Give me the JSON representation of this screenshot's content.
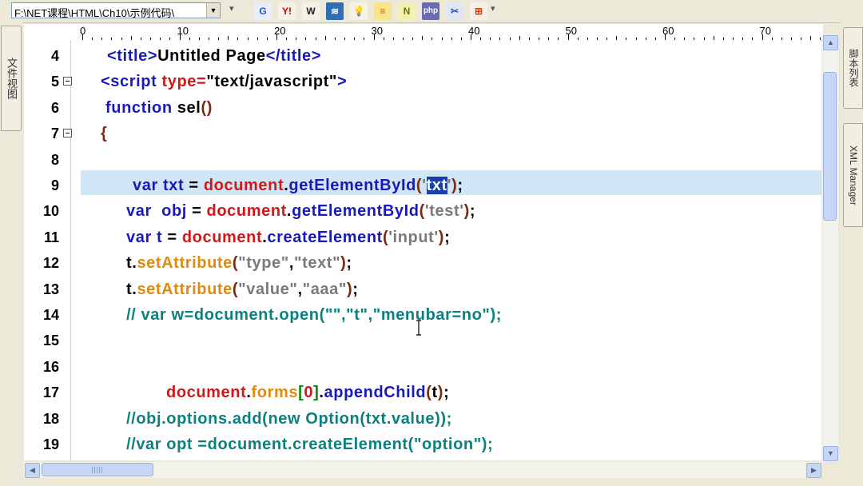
{
  "toolbar": {
    "path": "F:\\NET课程\\HTML\\Ch10\\示例代码\\",
    "buttons": [
      {
        "name": "google",
        "label": "G",
        "color": "#2255cc",
        "bg": "#e8eefc"
      },
      {
        "name": "yahoo",
        "label": "Y!",
        "color": "#cc0000",
        "bg": "#f4f1e6"
      },
      {
        "name": "wikipedia",
        "label": "W",
        "color": "#222222",
        "bg": "#f4f1e6"
      },
      {
        "name": "stackoverflow",
        "label": "≋",
        "color": "#ffffff",
        "bg": "#2f6db5"
      },
      {
        "name": "lightbulb",
        "label": "💡",
        "color": "#c9a000",
        "bg": "#f4f1e6"
      },
      {
        "name": "notes",
        "label": "≡",
        "color": "#a07000",
        "bg": "#f8e48a"
      },
      {
        "name": "n-button",
        "label": "N",
        "color": "#5a7a10",
        "bg": "#f6f0b0"
      },
      {
        "name": "php",
        "label": "php",
        "color": "#ffffff",
        "bg": "#6a6ab0"
      },
      {
        "name": "tools",
        "label": "✂",
        "color": "#3050a0",
        "bg": "#e0e6f6"
      },
      {
        "name": "windows",
        "label": "⊞",
        "color": "#d04010",
        "bg": "#f4f1e6"
      }
    ]
  },
  "left_panel": {
    "tab_label": "文件视图"
  },
  "right_panel": {
    "tabs": [
      "脚本列表",
      "XML Manager"
    ]
  },
  "ruler": {
    "labels": [
      "0",
      "10",
      "20",
      "30",
      "40",
      "50",
      "60",
      "70"
    ]
  },
  "editor": {
    "lines": [
      {
        "num": "4",
        "fold": false,
        "indent": 104,
        "tokens": [
          [
            "tag",
            "<title>"
          ],
          [
            "dk",
            "Untitled Page"
          ],
          [
            "tag",
            "</title>"
          ]
        ]
      },
      {
        "num": "5",
        "fold": true,
        "indent": 96,
        "tokens": [
          [
            "tag",
            "<script "
          ],
          [
            "at",
            "type="
          ],
          [
            "dk",
            "\"text/javascript\""
          ],
          [
            "tag",
            ">"
          ]
        ]
      },
      {
        "num": "6",
        "fold": false,
        "indent": 102,
        "tokens": [
          [
            "kw",
            "function "
          ],
          [
            "dk",
            "sel"
          ],
          [
            "br",
            "()"
          ]
        ]
      },
      {
        "num": "7",
        "fold": true,
        "indent": 96,
        "tokens": [
          [
            "br",
            "{"
          ]
        ]
      },
      {
        "num": "8",
        "fold": false,
        "indent": 0,
        "tokens": []
      },
      {
        "num": "9",
        "fold": false,
        "indent": 136,
        "highlight": true,
        "tokens": [
          [
            "kw",
            "var "
          ],
          [
            "bl",
            "txt "
          ],
          [
            "dk",
            "= "
          ],
          [
            "rd",
            "document"
          ],
          [
            "dk",
            "."
          ],
          [
            "bl",
            "getElementById"
          ],
          [
            "br",
            "("
          ],
          [
            "gy",
            "'"
          ],
          [
            "sel",
            "txt"
          ],
          [
            "gy",
            "'"
          ],
          [
            "br",
            ")"
          ],
          [
            "dk",
            ";"
          ]
        ]
      },
      {
        "num": "10",
        "fold": false,
        "indent": 128,
        "tokens": [
          [
            "kw",
            "var  "
          ],
          [
            "bl",
            "obj "
          ],
          [
            "dk",
            "= "
          ],
          [
            "rd",
            "document"
          ],
          [
            "dk",
            "."
          ],
          [
            "bl",
            "getElementById"
          ],
          [
            "br",
            "("
          ],
          [
            "gy",
            "'test'"
          ],
          [
            "br",
            ")"
          ],
          [
            "dk",
            ";"
          ]
        ]
      },
      {
        "num": "11",
        "fold": false,
        "indent": 128,
        "tokens": [
          [
            "kw",
            "var "
          ],
          [
            "bl",
            "t "
          ],
          [
            "dk",
            "= "
          ],
          [
            "rd",
            "document"
          ],
          [
            "dk",
            "."
          ],
          [
            "bl",
            "createElement"
          ],
          [
            "br",
            "("
          ],
          [
            "gy",
            "'input'"
          ],
          [
            "br",
            ")"
          ],
          [
            "dk",
            ";"
          ]
        ]
      },
      {
        "num": "12",
        "fold": false,
        "indent": 128,
        "tokens": [
          [
            "dk",
            "t"
          ],
          [
            "dk",
            "."
          ],
          [
            "or",
            "setAttribute"
          ],
          [
            "br",
            "("
          ],
          [
            "gy",
            "\"type\""
          ],
          [
            "dk",
            ","
          ],
          [
            "gy",
            "\"text\""
          ],
          [
            "br",
            ")"
          ],
          [
            "dk",
            ";"
          ]
        ]
      },
      {
        "num": "13",
        "fold": false,
        "indent": 128,
        "tokens": [
          [
            "dk",
            "t"
          ],
          [
            "dk",
            "."
          ],
          [
            "or",
            "setAttribute"
          ],
          [
            "br",
            "("
          ],
          [
            "gy",
            "\"value\""
          ],
          [
            "dk",
            ","
          ],
          [
            "gy",
            "\"aaa\""
          ],
          [
            "br",
            ")"
          ],
          [
            "dk",
            ";"
          ]
        ]
      },
      {
        "num": "14",
        "fold": false,
        "indent": 128,
        "tokens": [
          [
            "cm",
            "// var w=document.open(\"\",\"t\",\"menubar=no\");"
          ]
        ]
      },
      {
        "num": "15",
        "fold": false,
        "indent": 0,
        "tokens": []
      },
      {
        "num": "16",
        "fold": false,
        "indent": 0,
        "tokens": []
      },
      {
        "num": "17",
        "fold": false,
        "indent": 178,
        "tokens": [
          [
            "rd",
            "document"
          ],
          [
            "dk",
            "."
          ],
          [
            "or",
            "forms"
          ],
          [
            "gn",
            "["
          ],
          [
            "rd",
            "0"
          ],
          [
            "gn",
            "]"
          ],
          [
            "dk",
            "."
          ],
          [
            "bl",
            "appendChild"
          ],
          [
            "br",
            "("
          ],
          [
            "dk",
            "t"
          ],
          [
            "br",
            ")"
          ],
          [
            "dk",
            ";"
          ]
        ]
      },
      {
        "num": "18",
        "fold": false,
        "indent": 128,
        "tokens": [
          [
            "cm",
            "//obj.options.add(new Option(txt.value));"
          ]
        ]
      },
      {
        "num": "19",
        "fold": false,
        "indent": 128,
        "tokens": [
          [
            "cm",
            "//var opt =document.createElement(\"option\");"
          ]
        ]
      }
    ]
  },
  "scroll": {
    "up": "▲",
    "down": "▼",
    "left": "◀",
    "right": "▶"
  }
}
